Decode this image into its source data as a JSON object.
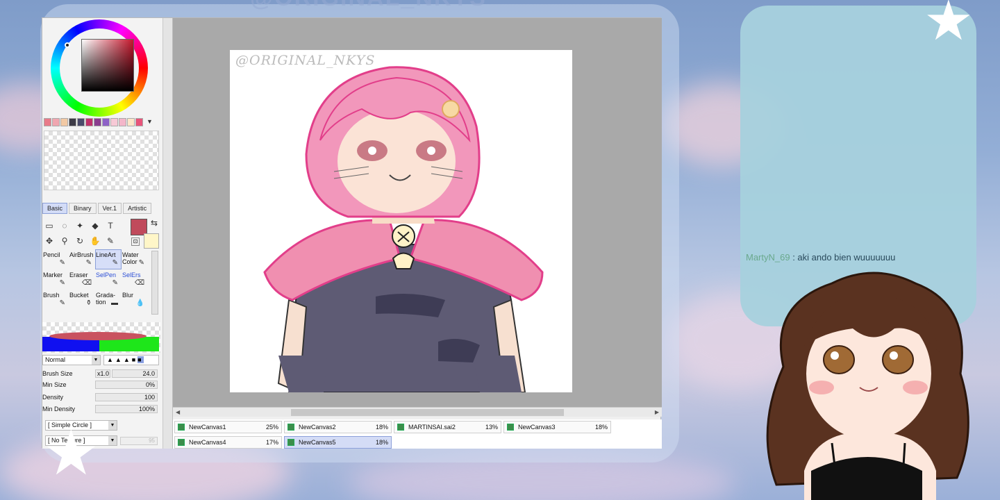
{
  "stream": {
    "watermark": "@ORIGINAL_NKYS",
    "chat": {
      "user": "MartyN_69",
      "separator": " : ",
      "message": "aki ando bien wuuuuuuu"
    }
  },
  "sai": {
    "colors": {
      "primary": "#c04a5c",
      "secondary": "#fff6c8",
      "swatches": [
        "#e87b8a",
        "#f0a6b0",
        "#f2c9a4",
        "#3d3b47",
        "#4a4a6a",
        "#c0316a",
        "#8a3d8e",
        "#8e62c7",
        "#f7c9d6",
        "#f3b6c9",
        "#fde6c8",
        "#e8547a"
      ]
    },
    "tool_tabs": [
      "Basic",
      "Binary",
      "Ver.1",
      "Artistic"
    ],
    "tool_icons": [
      "select-rect-icon",
      "lasso-icon",
      "magic-wand-icon",
      "fill-select-icon",
      "text-icon",
      "move-icon",
      "zoom-icon",
      "rotate-icon",
      "hand-icon",
      "eyedropper-icon"
    ],
    "text_tool_glyph": "T",
    "brushes": [
      {
        "label": "Pencil",
        "active": false,
        "blue": false
      },
      {
        "label": "AirBrush",
        "active": false,
        "blue": false
      },
      {
        "label": "LineArt",
        "active": true,
        "blue": false
      },
      {
        "label": "Water Color",
        "active": false,
        "blue": false
      },
      {
        "label": "Marker",
        "active": false,
        "blue": false
      },
      {
        "label": "Eraser",
        "active": false,
        "blue": false
      },
      {
        "label": "SelPen",
        "active": false,
        "blue": true
      },
      {
        "label": "SelErs",
        "active": false,
        "blue": true
      },
      {
        "label": "Brush",
        "active": false,
        "blue": false
      },
      {
        "label": "Bucket",
        "active": false,
        "blue": false
      },
      {
        "label": "Grada- tion",
        "active": false,
        "blue": false
      },
      {
        "label": "Blur",
        "active": false,
        "blue": false
      }
    ],
    "blend_mode": "Normal",
    "brush_size": {
      "label": "Brush Size",
      "multiplier": "x1.0",
      "value": "24.0"
    },
    "min_size": {
      "label": "Min Size",
      "value": "0%"
    },
    "density": {
      "label": "Density",
      "value": "100"
    },
    "min_density": {
      "label": "Min Density",
      "value": "100%"
    },
    "shape": "[ Simple Circle ]",
    "texture": "[ No Texture ]",
    "texture_strength": "95",
    "canvas_signature": "@ORIGINAL_NKYS",
    "documents": [
      {
        "name": "NewCanvas1",
        "zoom": "25%",
        "active": false
      },
      {
        "name": "NewCanvas2",
        "zoom": "18%",
        "active": false
      },
      {
        "name": "MARTINSAI.sai2",
        "zoom": "13%",
        "active": false
      },
      {
        "name": "NewCanvas3",
        "zoom": "18%",
        "active": false
      },
      {
        "name": "NewCanvas4",
        "zoom": "17%",
        "active": false
      },
      {
        "name": "NewCanvas5",
        "zoom": "18%",
        "active": true
      }
    ]
  }
}
